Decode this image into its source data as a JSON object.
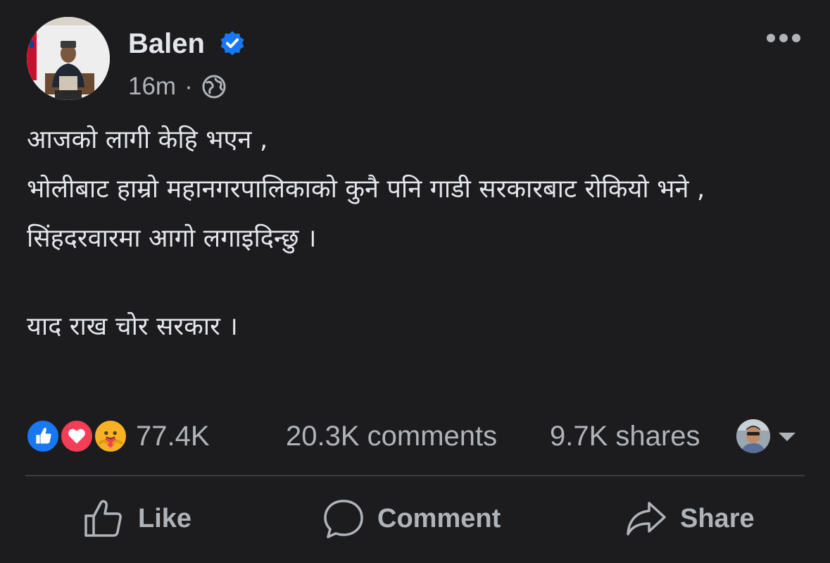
{
  "post": {
    "author": "Balen",
    "verified": true,
    "timestamp": "16m",
    "separator": "·",
    "audience_icon": "globe-icon",
    "more_icon": "more-options-icon",
    "body_lines": [
      "आजको लागी केहि भएन ,",
      "भोलीबाट हाम्रो महानगरपालिकाको कुनै पनि गाडी सरकारबाट रोकियो भने ,",
      "सिंहदरवारमा आगो लगाइदिन्छु ।",
      "",
      "याद राख चोर सरकार ।"
    ]
  },
  "stats": {
    "reactions": [
      "like",
      "love",
      "care"
    ],
    "reaction_count": "77.4K",
    "comments": "20.3K comments",
    "shares": "9.7K shares"
  },
  "actions": {
    "like": "Like",
    "comment": "Comment",
    "share": "Share"
  },
  "colors": {
    "background": "#1c1c1e",
    "text": "#e4e6eb",
    "muted": "#b0b3b8",
    "verified": "#1877f2",
    "like": "#1877f2",
    "love": "#f33e58",
    "care": "#f7b125",
    "divider": "#3a3b3c"
  }
}
